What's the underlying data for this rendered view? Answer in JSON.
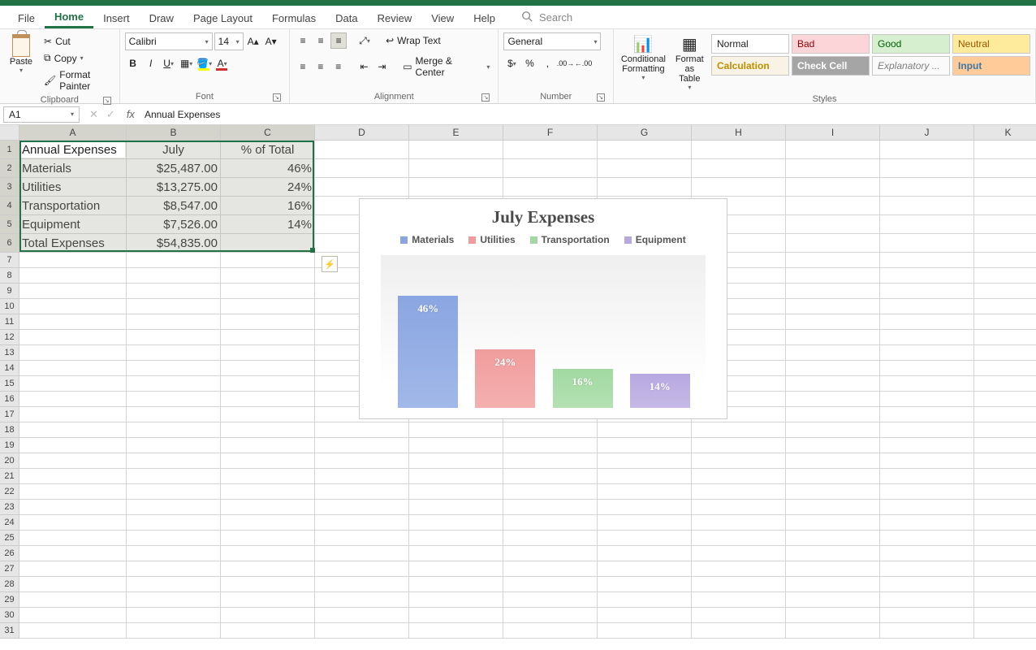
{
  "tabs": [
    "File",
    "Home",
    "Insert",
    "Draw",
    "Page Layout",
    "Formulas",
    "Data",
    "Review",
    "View",
    "Help"
  ],
  "active_tab": "Home",
  "search_placeholder": "Search",
  "ribbon": {
    "clipboard": {
      "paste": "Paste",
      "cut": "Cut",
      "copy": "Copy",
      "brush": "Format Painter",
      "label": "Clipboard"
    },
    "font": {
      "name": "Calibri",
      "size": "14",
      "label": "Font"
    },
    "alignment": {
      "wrap": "Wrap Text",
      "merge": "Merge & Center",
      "label": "Alignment"
    },
    "number": {
      "format": "General",
      "label": "Number"
    },
    "styles": {
      "cond": "Conditional Formatting",
      "table": "Format as Table",
      "label": "Styles",
      "cells": [
        "Normal",
        "Bad",
        "Good",
        "Neutral",
        "Calculation",
        "Check Cell",
        "Explanatory ...",
        "Input"
      ]
    }
  },
  "name_box": "A1",
  "formula_bar": "Annual Expenses",
  "columns": [
    {
      "l": "A",
      "w": 132
    },
    {
      "l": "B",
      "w": 116
    },
    {
      "l": "C",
      "w": 116
    },
    {
      "l": "D",
      "w": 116
    },
    {
      "l": "E",
      "w": 116
    },
    {
      "l": "F",
      "w": 116
    },
    {
      "l": "G",
      "w": 116
    },
    {
      "l": "H",
      "w": 116
    },
    {
      "l": "I",
      "w": 116
    },
    {
      "l": "J",
      "w": 116
    },
    {
      "l": "K",
      "w": 84
    }
  ],
  "data_rows": [
    {
      "n": 1,
      "a": "Annual Expenses",
      "b": "July",
      "c": "% of Total",
      "a_align": "left",
      "b_align": "center",
      "c_align": "center"
    },
    {
      "n": 2,
      "a": "Materials",
      "b": "$25,487.00",
      "c": "46%",
      "a_align": "left",
      "b_align": "right",
      "c_align": "right"
    },
    {
      "n": 3,
      "a": "Utilities",
      "b": "$13,275.00",
      "c": "24%",
      "a_align": "left",
      "b_align": "right",
      "c_align": "right"
    },
    {
      "n": 4,
      "a": "Transportation",
      "b": "$8,547.00",
      "c": "16%",
      "a_align": "left",
      "b_align": "right",
      "c_align": "right"
    },
    {
      "n": 5,
      "a": "Equipment",
      "b": "$7,526.00",
      "c": "14%",
      "a_align": "left",
      "b_align": "right",
      "c_align": "right"
    },
    {
      "n": 6,
      "a": "Total Expenses",
      "b": "$54,835.00",
      "c": "",
      "a_align": "left",
      "b_align": "right",
      "c_align": "right"
    }
  ],
  "empty_row_count": 25,
  "chart_data": {
    "type": "bar",
    "title": "July Expenses",
    "categories": [
      "Materials",
      "Utilities",
      "Transportation",
      "Equipment"
    ],
    "values": [
      46,
      24,
      16,
      14
    ],
    "value_labels": [
      "46%",
      "24%",
      "16%",
      "14%"
    ],
    "colors": [
      "#8aa6e2",
      "#f19c9c",
      "#a1d9a1",
      "#b7a8e0"
    ],
    "ylim": [
      0,
      50
    ],
    "xlabel": "",
    "ylabel": ""
  }
}
